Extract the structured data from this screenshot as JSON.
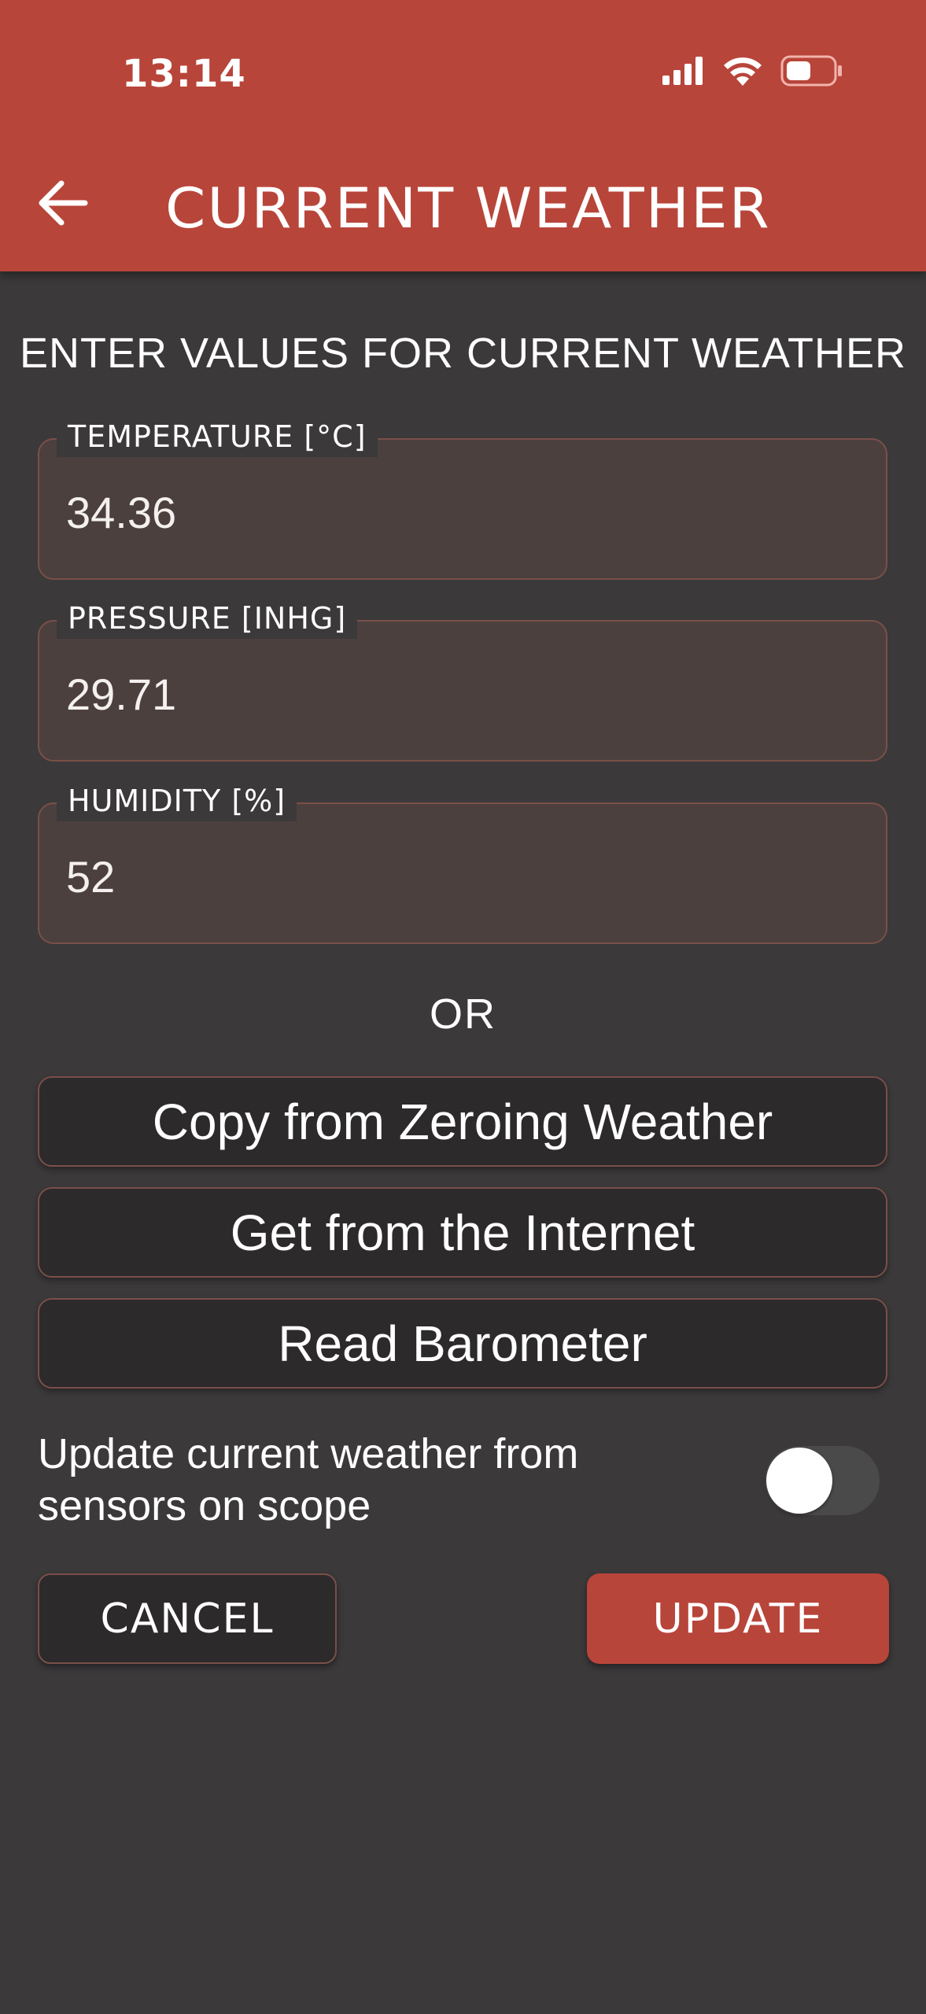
{
  "status_bar": {
    "time": "13:14",
    "icons": [
      "cellular-signal-icon",
      "wifi-icon",
      "battery-icon"
    ]
  },
  "header": {
    "back_icon": "arrow-left-icon",
    "title": "CURRENT WEATHER"
  },
  "main": {
    "heading": "ENTER VALUES FOR CURRENT WEATHER",
    "fields": [
      {
        "label": "TEMPERATURE [°C]",
        "value": "34.36"
      },
      {
        "label": "PRESSURE [INHG]",
        "value": "29.71"
      },
      {
        "label": "HUMIDITY [%]",
        "value": "52"
      }
    ],
    "or_text": "OR",
    "source_buttons": [
      {
        "label": "Copy from Zeroing Weather"
      },
      {
        "label": "Get from the Internet"
      },
      {
        "label": "Read Barometer"
      }
    ],
    "sensor_toggle": {
      "label": "Update current weather from sensors on scope",
      "on": false
    }
  },
  "actions": {
    "cancel_label": "CANCEL",
    "update_label": "UPDATE"
  },
  "colors": {
    "accent": "#b8453a",
    "background": "#3b393a",
    "field_fill": "#4c403e",
    "field_border": "#7a4f49",
    "button_fill": "#2c2a2b"
  }
}
